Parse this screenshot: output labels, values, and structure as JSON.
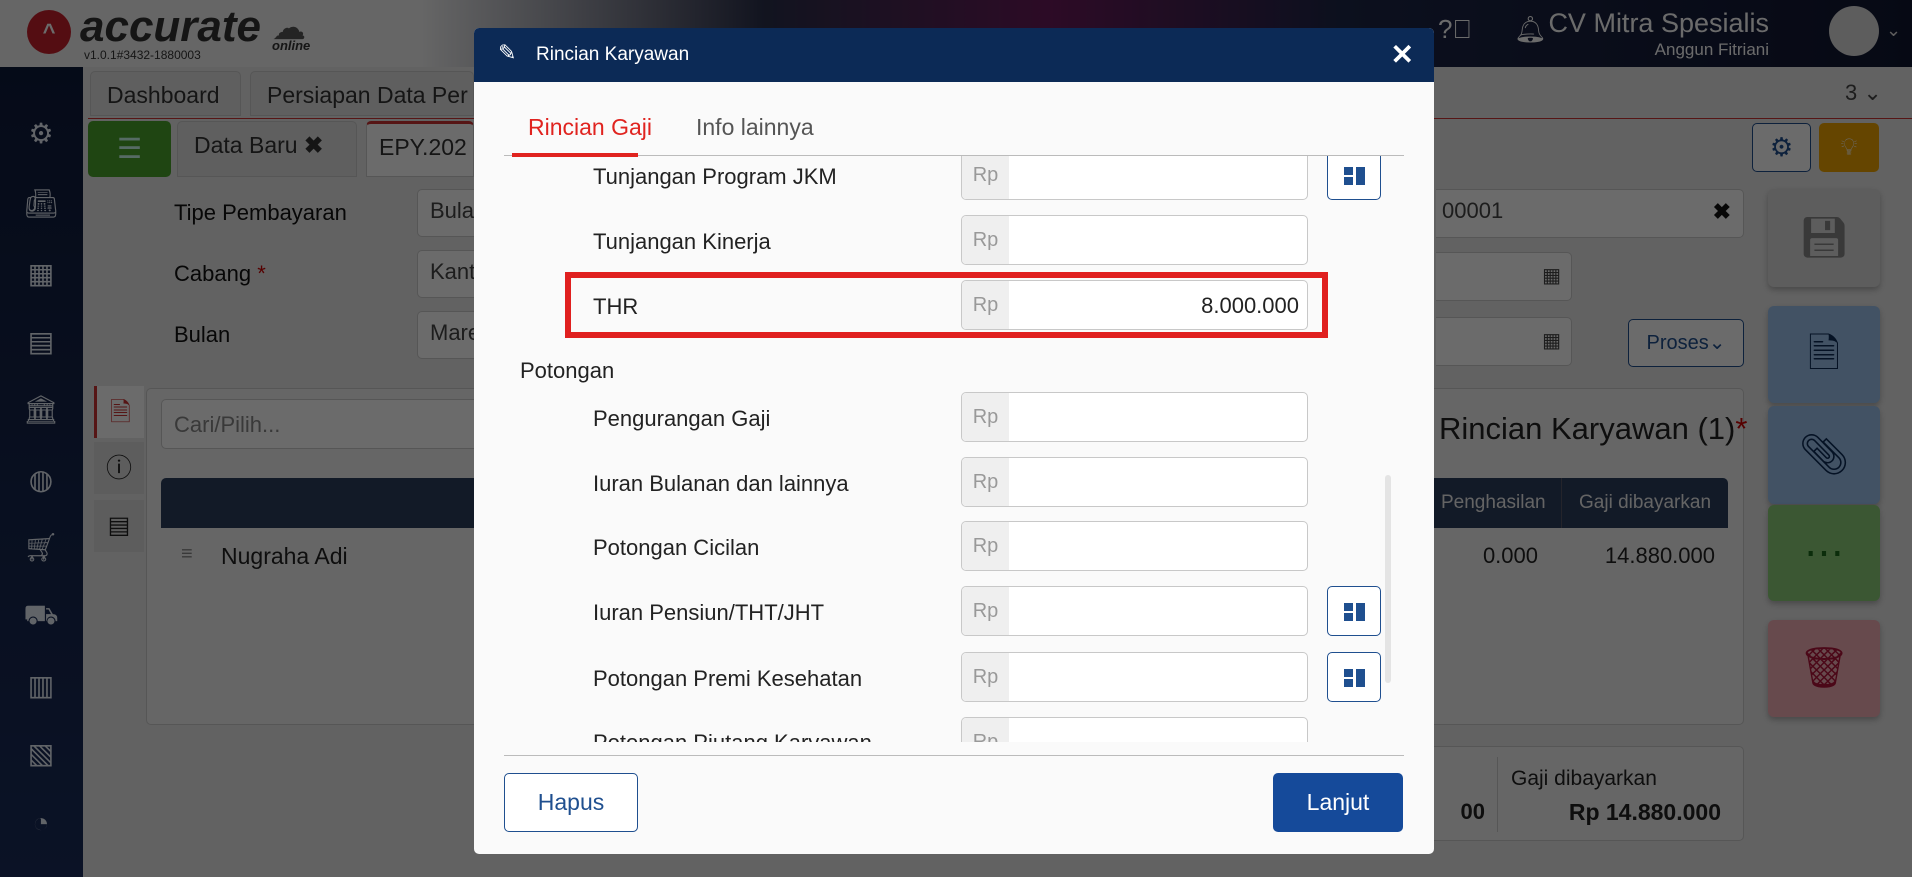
{
  "app": {
    "logo_text": "accurate",
    "logo_sub": "online",
    "version": "v1.0.1#3432-1880003",
    "company": "CV Mitra Spesialis",
    "user": "Anggun Fitriani"
  },
  "tabs": {
    "row1": [
      "Dashboard",
      "Persiapan Data Per"
    ],
    "row1_count": "3",
    "row2": [
      "Data Baru",
      "EPY.202"
    ]
  },
  "form": {
    "labels": {
      "tipe": "Tipe Pembayaran",
      "cabang": "Cabang",
      "bulan": "Bulan"
    },
    "values": {
      "tipe": "Bula",
      "cabang": "Kant",
      "bulan": "Mare",
      "number": "00001"
    },
    "proses": "Proses",
    "required_mark": "*"
  },
  "detail": {
    "search_placeholder": "Cari/Pilih...",
    "title": "Rincian Karyawan (1)",
    "columns": [
      "Penghasilan",
      "Gaji dibayarkan"
    ],
    "row": {
      "name": "Nugraha Adi",
      "income": "0.000",
      "paid": "14.880.000"
    },
    "summary": {
      "left_value": "00",
      "label": "Gaji dibayarkan",
      "value": "Rp 14.880.000"
    }
  },
  "modal": {
    "title": "Rincian Karyawan",
    "tabs": [
      "Rincian Gaji",
      "Info lainnya"
    ],
    "active_tab": "Rincian Gaji",
    "currency": "Rp",
    "income_rows": [
      {
        "label": "Tunjangan Program JKM",
        "value": "",
        "calc": true
      },
      {
        "label": "Tunjangan Kinerja",
        "value": "",
        "calc": false
      },
      {
        "label": "THR",
        "value": "8.000.000",
        "calc": false
      }
    ],
    "deduction_header": "Potongan",
    "deduction_rows": [
      {
        "label": "Pengurangan Gaji",
        "value": "",
        "calc": false
      },
      {
        "label": "Iuran Bulanan dan lainnya",
        "value": "",
        "calc": false
      },
      {
        "label": "Potongan Cicilan",
        "value": "",
        "calc": false
      },
      {
        "label": "Iuran Pensiun/THT/JHT",
        "value": "",
        "calc": true
      },
      {
        "label": "Potongan Premi Kesehatan",
        "value": "",
        "calc": true
      },
      {
        "label": "Potongan Piutang Karyawan",
        "value": "",
        "calc": false
      }
    ],
    "buttons": {
      "delete": "Hapus",
      "next": "Lanjut"
    }
  },
  "colors": {
    "accent": "#e0231f",
    "primary": "#154a9a",
    "header": "#0c2a56"
  }
}
